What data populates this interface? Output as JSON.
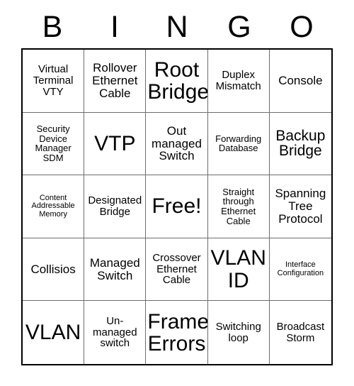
{
  "header": {
    "letters": [
      "B",
      "I",
      "N",
      "G",
      "O"
    ]
  },
  "grid": {
    "rows": 5,
    "columns": 5,
    "border_color": "#000000",
    "cell_line_color": "#6d6d6d",
    "background_color": "#ffffff",
    "text_color": "#000000",
    "cells": [
      {
        "text": "Virtual Terminal VTY",
        "size": "s"
      },
      {
        "text": "Rollover Ethernet Cable",
        "size": "m"
      },
      {
        "text": "Root Bridge",
        "size": "xxl"
      },
      {
        "text": "Duplex Mismatch",
        "size": "s"
      },
      {
        "text": "Console",
        "size": "m"
      },
      {
        "text": "Security Device Manager SDM",
        "size": "xs"
      },
      {
        "text": "VTP",
        "size": "xxl"
      },
      {
        "text": "Out managed Switch",
        "size": "m"
      },
      {
        "text": "Forwarding Database",
        "size": "xs"
      },
      {
        "text": "Backup Bridge",
        "size": "l"
      },
      {
        "text": "Content Addressable Memory",
        "size": "xxs"
      },
      {
        "text": "Designated Bridge",
        "size": "s"
      },
      {
        "text": "Free!",
        "size": "xxl"
      },
      {
        "text": "Straight through Ethernet Cable",
        "size": "xs"
      },
      {
        "text": "Spanning Tree Protocol",
        "size": "m"
      },
      {
        "text": "Collisios",
        "size": "m"
      },
      {
        "text": "Managed Switch",
        "size": "m"
      },
      {
        "text": "Crossover Ethernet Cable",
        "size": "s"
      },
      {
        "text": "VLAN ID",
        "size": "xxl"
      },
      {
        "text": "Interface Configuration",
        "size": "xxs"
      },
      {
        "text": "VLAN",
        "size": "xxl"
      },
      {
        "text": "Un-managed switch",
        "size": "s"
      },
      {
        "text": "Frame Errors",
        "size": "xxl"
      },
      {
        "text": "Switching loop",
        "size": "s"
      },
      {
        "text": "Broadcast Storm",
        "size": "s"
      }
    ]
  }
}
